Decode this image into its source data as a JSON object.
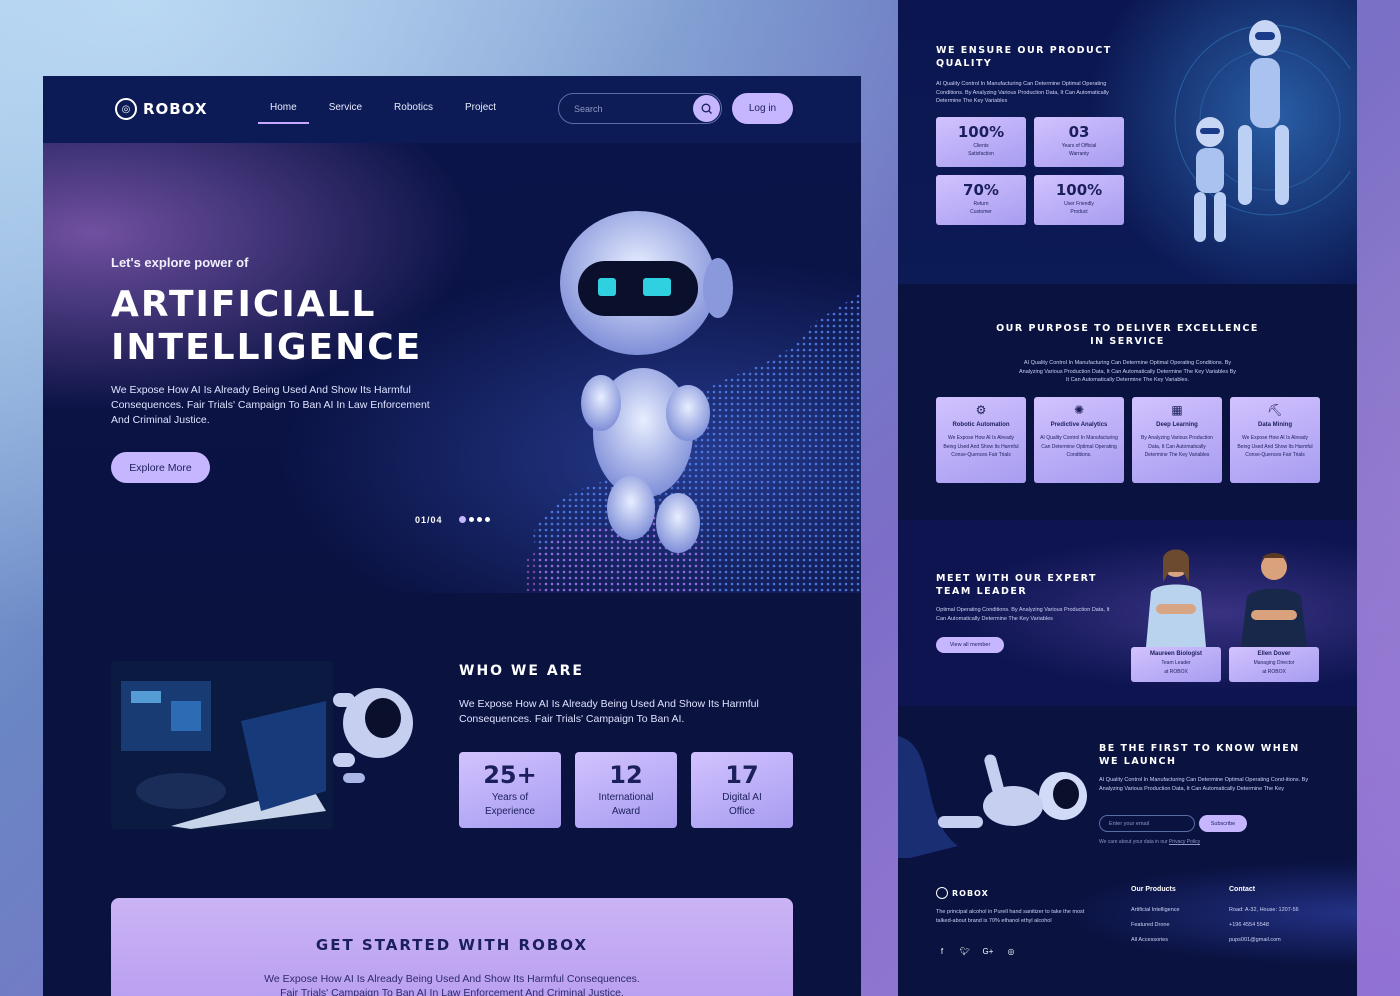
{
  "brand": {
    "name": "ROBOX"
  },
  "nav": {
    "links": [
      "Home",
      "Service",
      "Robotics",
      "Project"
    ],
    "active": "Home",
    "search_placeholder": "Search",
    "login_label": "Log in"
  },
  "hero": {
    "eyebrow": "Let's explore power of",
    "title_line1": "ARTIFICIALL",
    "title_line2": "INTELLIGENCE",
    "description": "We Expose How AI Is Already Being Used And Show Its Harmful Consequences. Fair Trials' Campaign To Ban AI In Law Enforcement And Criminal Justice.",
    "cta_label": "Explore More",
    "slide_counter": "01/04",
    "slide_count": 4,
    "active_slide": 1
  },
  "who": {
    "title": "WHO WE ARE",
    "description": "We Expose How AI Is Already Being Used And Show Its Harmful Consequences. Fair Trials' Campaign To Ban AI.",
    "stats": [
      {
        "value": "25+",
        "label_line1": "Years of",
        "label_line2": "Experience"
      },
      {
        "value": "12",
        "label_line1": "International",
        "label_line2": "Award"
      },
      {
        "value": "17",
        "label_line1": "Digital AI",
        "label_line2": "Office"
      }
    ]
  },
  "get_started": {
    "title": "GET STARTED WITH ROBOX",
    "description_line1": "We Expose How AI Is Already Being Used And Show Its Harmful Consequences.",
    "description_line2": "Fair Trials' Campaign To Ban AI In Law Enforcement And Criminal Justice."
  },
  "quality": {
    "title_line1": "WE ENSURE OUR PRODUCT",
    "title_line2": "QUALITY",
    "description": "AI Quality Control In Manufacturing Can Determine Optimal Operating Conditions. By Analyzing Various Production Data, It Can Automatically Determine The Key Variables",
    "cards": [
      {
        "value": "100%",
        "label_line1": "Clients",
        "label_line2": "Satisfaction"
      },
      {
        "value": "03",
        "label_line1": "Years of Official",
        "label_line2": "Warranty"
      },
      {
        "value": "70%",
        "label_line1": "Return",
        "label_line2": "Customer"
      },
      {
        "value": "100%",
        "label_line1": "User Friendly",
        "label_line2": "Product"
      }
    ]
  },
  "purpose": {
    "title_line1": "OUR PURPOSE TO DELIVER EXCELLENCE",
    "title_line2": "IN SERVICE",
    "description_line1": "AI Quality Control In Manufacturing Can Determine Optimal Operating Conditions. By",
    "description_line2": "Analyzing Various Production Data, It Can Automatically Determine The Key Variables By",
    "description_line3": "It Can Automatically Determine The Key Variables.",
    "cards": [
      {
        "icon": "robot-arm-icon",
        "title": "Robotic Automation",
        "desc": "We Expose How AI Is Already Being Used And Show Its Harmful Conse-Quences Fair Trials"
      },
      {
        "icon": "brain-chart-icon",
        "title": "Predictive Analytics",
        "desc": "AI Quality Control In Manufacturing Can Determine Optimal Operating Conditions."
      },
      {
        "icon": "neural-net-icon",
        "title": "Deep Learning",
        "desc": "By Analyzing Various Production Data, It Can Automatically Determine The Key Variables"
      },
      {
        "icon": "data-mining-icon",
        "title": "Data Mining",
        "desc": "We Expose How AI Is Already Being Used And Show Its Harmful Conse-Quences Fair Trials"
      }
    ]
  },
  "team": {
    "title_line1": "MEET WITH OUR EXPERT",
    "title_line2": "TEAM LEADER",
    "description": "Optimal Operating Conditions. By Analyzing Various Production Data, It Can Automatically Determine The Key Variables",
    "view_all_label": "View all member",
    "members": [
      {
        "name": "Maureen Biologist",
        "role_line1": "Team Leader",
        "role_line2": "at ROBOX"
      },
      {
        "name": "Ellen Dover",
        "role_line1": "Managing Director",
        "role_line2": "at ROBOX"
      }
    ]
  },
  "launch": {
    "title_line1": "BE THE FIRST TO KNOW WHEN",
    "title_line2": "WE LAUNCH",
    "description": "AI Quality Control In Manufacturing Can Determine Optimal Operating Cond-itions. By Analyzing Various Production Data, It Can Automatically Determine The Key",
    "email_placeholder": "Enter your email",
    "subscribe_label": "Subscribe",
    "privacy_text": "We care about your data in our",
    "privacy_link": "Privacy Policy"
  },
  "footer": {
    "brand": "ROBOX",
    "description": "The principal alcohol in Purell hand sanitizer to take the most talked-about brand is 70% ethanol ethyl alcohol",
    "products_title": "Our Products",
    "products": [
      "Artificial Intelligence",
      "Featured Drone",
      "All Accessories"
    ],
    "contact_title": "Contact",
    "contacts": [
      "Road: A-32, House: 1207-56",
      "+196 4554 5548",
      "pups001@gmail.com"
    ],
    "socials": [
      "facebook-icon",
      "twitter-icon",
      "google-plus-icon",
      "instagram-icon"
    ]
  },
  "colors": {
    "accent": "#c6b6ff",
    "navy": "#0a1240",
    "card_text": "#1b1f5a"
  }
}
